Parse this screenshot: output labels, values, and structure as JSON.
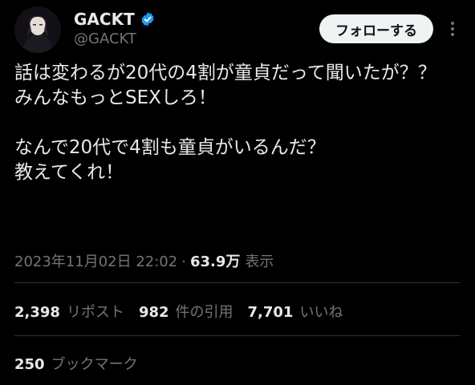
{
  "author": {
    "display_name": "GACKT",
    "handle": "@GACKT",
    "verified_icon": "verified-badge-icon",
    "verified_color": "#1d9bf0"
  },
  "follow_button_label": "フォローする",
  "tweet": {
    "text": "話は変わるが20代の4割が童貞だって聞いたが？？\nみんなもっとSEXしろ！\n\nなんで20代で4割も童貞がいるんだ？\n教えてくれ！"
  },
  "meta": {
    "timestamp": "2023年11月02日 22:02",
    "separator": "·",
    "views_count": "63.9万",
    "views_label": "表示"
  },
  "stats": {
    "reposts_count": "2,398",
    "reposts_label": "リポスト",
    "quotes_count": "982",
    "quotes_label": "件の引用",
    "likes_count": "7,701",
    "likes_label": "いいね"
  },
  "bookmarks": {
    "count": "250",
    "label": "ブックマーク"
  },
  "colors": {
    "background": "#000000",
    "text_primary": "#e7e9ea",
    "text_secondary": "#71767b",
    "divider": "#2f3336",
    "button_bg": "#eff3f4"
  }
}
